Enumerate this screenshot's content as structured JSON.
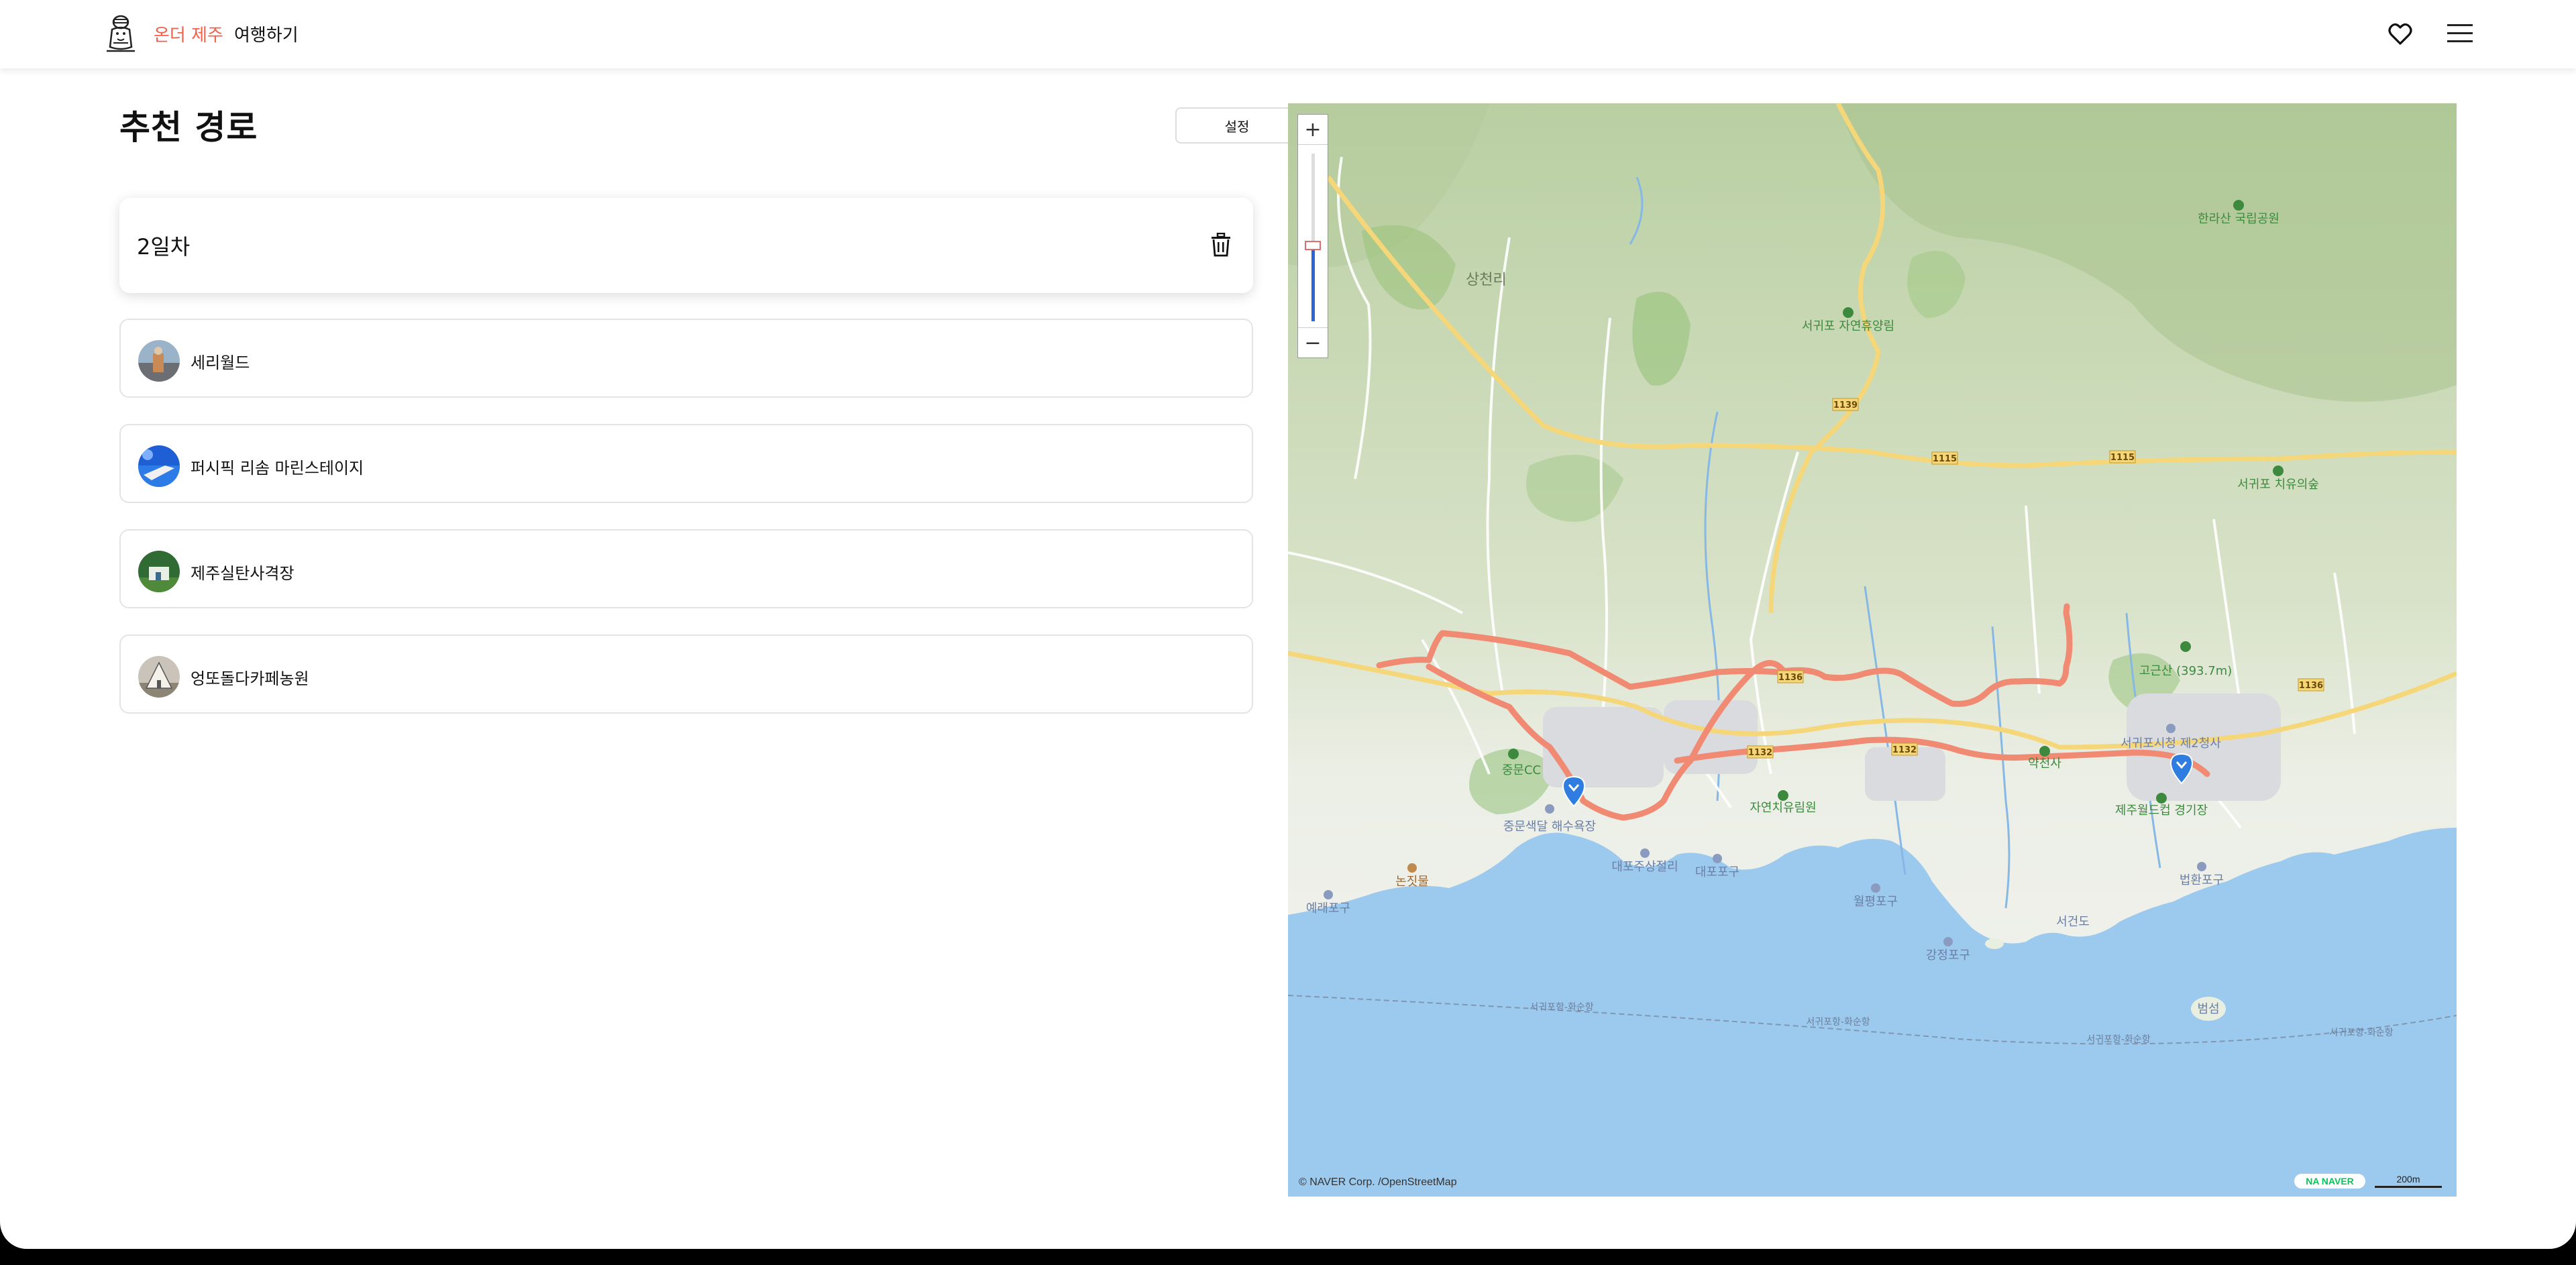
{
  "header": {
    "brand": "온더 제주",
    "nav_travel": "여행하기",
    "icons": {
      "logo": "dol-hareubang-logo",
      "favorites": "heart-icon",
      "menu": "hamburger-menu-icon"
    }
  },
  "route": {
    "title": "추천 경로",
    "settings_label": "설정",
    "day_label": "2일차",
    "delete_icon": "trash-icon",
    "places": [
      {
        "name": "세리월드"
      },
      {
        "name": "퍼시픽 리솜 마린스테이지"
      },
      {
        "name": "제주실탄사격장"
      },
      {
        "name": "엉또돌다카페농원"
      }
    ]
  },
  "map": {
    "zoom_in": "+",
    "zoom_out": "−",
    "attribution": "© NAVER Corp. /OpenStreetMap",
    "naver_logo": "NA NAVER",
    "scale": "200m",
    "colors": {
      "sea": "#9cc9ee",
      "route": "#f08a73",
      "marker": "#2f7de1",
      "road": "#f5d77a"
    },
    "labels": {
      "samcheonri": "상천리",
      "rest_forest": "서귀포 자연휴양림",
      "hallasan_park": "한라산 국립공원",
      "seogwipo_healing": "서귀포 치유의숲",
      "gogunsan": "고근산 (393.7m)",
      "jungmun_cc": "중문CC",
      "jungmun_beach": "중문색달 해수욕장",
      "daepo": "대포주상절리",
      "daepo_port": "대포포구",
      "nonjitmul": "논짓물",
      "yeraepogu": "예래포구",
      "healing_forest": "자연치유림원",
      "wolpyeong": "월평포구",
      "gangjeong": "강정포구",
      "seogeondo": "서건도",
      "beomseom": "범섬",
      "beophwan": "법환포구",
      "world_cup": "제주월드컵 경기장",
      "city_hall": "서귀포시청 제2청사",
      "seogwipo_sunrin": "서귀포항-화순항",
      "yakcheon": "약천사",
      "r1139": "1139",
      "r1115": "1115",
      "r1136": "1136",
      "r1132": "1132"
    }
  }
}
